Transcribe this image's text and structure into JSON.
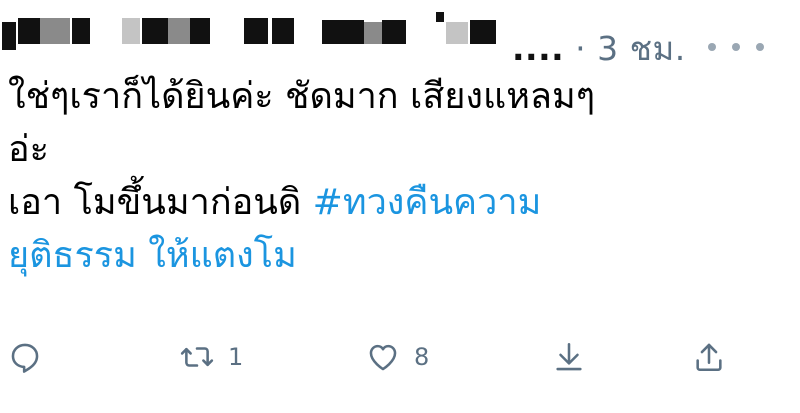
{
  "tweet": {
    "author_name_visible": "....",
    "separator": "·",
    "time_ago": "3 ชม.",
    "more_icon": "more-dots-icon",
    "text_lines": [
      "ใช่ๆเราก็ได้ยินค่ะ ชัดมาก เสียงแหลมๆ",
      "อ่ะ"
    ],
    "line3_text": "เอา โมขึ้นมาก่อนดิ ",
    "hashtag_part1": "#ทวงคืนความ",
    "hashtag_part2": "ยุติธรรม ให้แตงโม"
  },
  "actions": {
    "reply": {
      "icon": "reply-icon"
    },
    "retweet": {
      "icon": "retweet-icon",
      "count": "1"
    },
    "like": {
      "icon": "heart-icon",
      "count": "8"
    },
    "download": {
      "icon": "download-icon"
    },
    "share": {
      "icon": "share-icon"
    }
  },
  "colors": {
    "text": "#000000",
    "muted": "#5b7083",
    "hashtag": "#1b95e0"
  }
}
